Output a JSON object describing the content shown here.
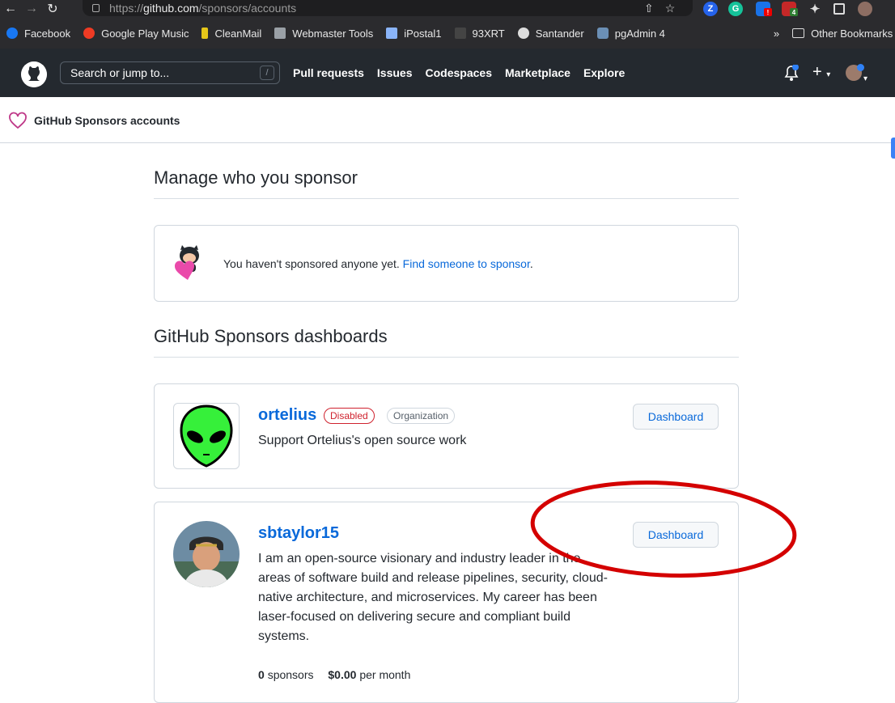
{
  "browser": {
    "url_scheme": "https://",
    "url_host": "github.com",
    "url_path": "/sponsors/accounts",
    "bookmarks": [
      "Facebook",
      "Google Play Music",
      "CleanMail",
      "Webmaster Tools",
      "iPostal1",
      "93XRT",
      "Santander",
      "pgAdmin 4"
    ],
    "bookmark_overflow": "»",
    "other_bookmarks": "Other Bookmarks",
    "ext_badges": [
      "Z",
      "G",
      "!",
      "4"
    ]
  },
  "header": {
    "search_placeholder": "Search or jump to...",
    "search_shortcut": "/",
    "nav": [
      "Pull requests",
      "Issues",
      "Codespaces",
      "Marketplace",
      "Explore"
    ]
  },
  "subheader": {
    "title": "GitHub Sponsors accounts"
  },
  "manage": {
    "heading": "Manage who you sponsor",
    "empty_text": "You haven't sponsored anyone yet. ",
    "empty_link": "Find someone to sponsor",
    "empty_end": "."
  },
  "dashboards": {
    "heading": "GitHub Sponsors dashboards",
    "accounts": [
      {
        "name": "ortelius",
        "badges": [
          "Disabled",
          "Organization"
        ],
        "description": "Support Ortelius's open source work",
        "button": "Dashboard"
      },
      {
        "name": "sbtaylor15",
        "description_lines": [
          "I am an open-source visionary and industry leader in the",
          "areas of software build and release pipelines, security, cloud-",
          "native architecture, and microservices. My career has been",
          "laser-focused on delivering secure and compliant build",
          "systems."
        ],
        "button": "Dashboard",
        "sponsors_count": "0",
        "sponsors_label": "sponsors",
        "amount": "$0.00",
        "amount_label": "per month"
      }
    ]
  },
  "colors": {
    "annotation": "#d40000",
    "link": "#0969da",
    "header": "#24292f"
  }
}
